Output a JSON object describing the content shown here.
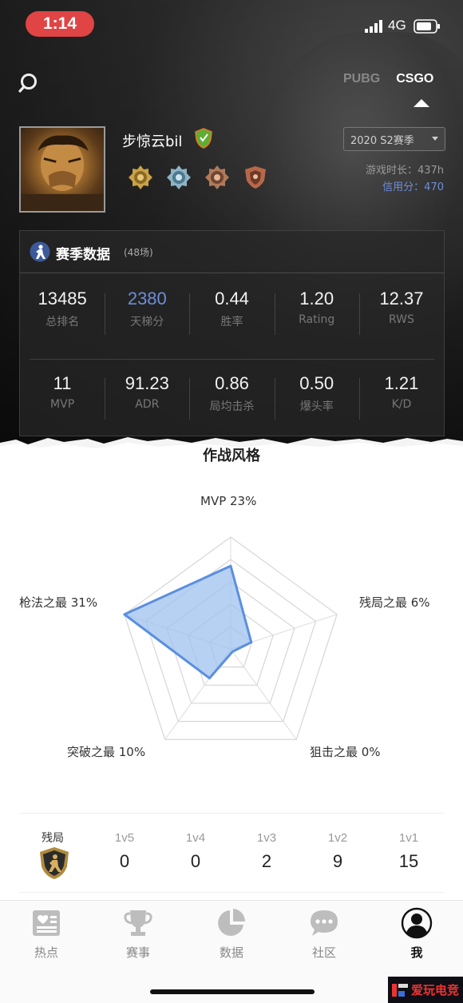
{
  "status_bar": {
    "time": "1:14",
    "network": "4G"
  },
  "game_tabs": [
    {
      "label": "PUBG",
      "active": false
    },
    {
      "label": "CSGO",
      "active": true
    }
  ],
  "profile": {
    "username": "步惊云bil",
    "season": "2020 S2赛季",
    "playtime": "游戏时长：437h",
    "credit": "信用分：470"
  },
  "season_stats": {
    "title": "赛季数据",
    "match_count": "(48场)",
    "row1": [
      {
        "value": "13485",
        "label": "总排名"
      },
      {
        "value": "2380",
        "label": "天梯分",
        "highlight": true
      },
      {
        "value": "0.44",
        "label": "胜率"
      },
      {
        "value": "1.20",
        "label": "Rating"
      },
      {
        "value": "12.37",
        "label": "RWS"
      }
    ],
    "row2": [
      {
        "value": "11",
        "label": "MVP"
      },
      {
        "value": "91.23",
        "label": "ADR"
      },
      {
        "value": "0.86",
        "label": "局均击杀"
      },
      {
        "value": "0.50",
        "label": "爆头率"
      },
      {
        "value": "1.21",
        "label": "K/D"
      }
    ]
  },
  "style_section": {
    "title": "作战风格",
    "radar": [
      {
        "name": "MVP",
        "label": "MVP 23%",
        "value": 23
      },
      {
        "name": "残局之最",
        "label": "残局之最 6%",
        "value": 6
      },
      {
        "name": "狙击之最",
        "label": "狙击之最 0%",
        "value": 0
      },
      {
        "name": "突破之最",
        "label": "突破之最 10%",
        "value": 10
      },
      {
        "name": "枪法之最",
        "label": "枪法之最 31%",
        "value": 31
      }
    ],
    "radar_max": 31
  },
  "clutch": {
    "title": "残局",
    "columns": [
      {
        "key": "1v5",
        "value": "0"
      },
      {
        "key": "1v4",
        "value": "0"
      },
      {
        "key": "1v3",
        "value": "2"
      },
      {
        "key": "1v2",
        "value": "9"
      },
      {
        "key": "1v1",
        "value": "15"
      }
    ]
  },
  "bottom_nav": [
    {
      "label": "热点",
      "icon": "news-icon",
      "active": false
    },
    {
      "label": "赛事",
      "icon": "trophy-icon",
      "active": false
    },
    {
      "label": "数据",
      "icon": "pie-chart-icon",
      "active": false
    },
    {
      "label": "社区",
      "icon": "chat-bubble-icon",
      "active": false
    },
    {
      "label": "我",
      "icon": "user-icon",
      "active": true
    }
  ],
  "colors": {
    "accent_blue": "#6e8ed8",
    "radar_fill": "#9fc2ef",
    "radar_stroke": "#5b8fe0",
    "alert_red": "#e04444"
  },
  "watermark": "爱玩电竞"
}
